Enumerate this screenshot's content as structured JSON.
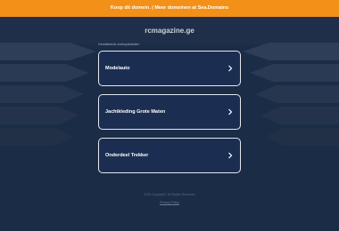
{
  "top_banner": "Koop dit domein. | Meer domeinen at Sea.Domains",
  "site_title": "rcmagazine.ge",
  "related_heading": "Gerelateerde zoekopdrachten",
  "links": [
    {
      "label": "Modelauto"
    },
    {
      "label": "Jachtkleding Grote Maten"
    },
    {
      "label": "Onderdeel Trekker"
    }
  ],
  "footer": {
    "copyright": "2025 Copyright | All Rights Reserved",
    "privacy": "Privacy Policy"
  },
  "colors": {
    "background": "#1b2c47",
    "banner": "#f29018",
    "card": "#1b2e52",
    "card_border": "#e4e8ef"
  },
  "icons": {
    "link_chevron": "chevron-right-icon"
  }
}
